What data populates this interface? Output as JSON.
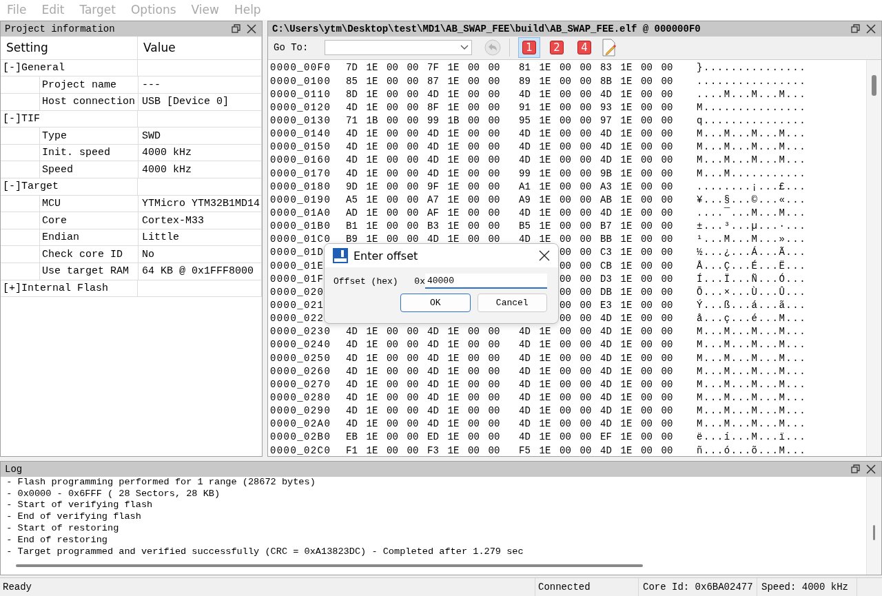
{
  "menu": [
    {
      "label": "File",
      "disabled": true
    },
    {
      "label": "Edit",
      "disabled": true
    },
    {
      "label": "Target",
      "disabled": true
    },
    {
      "label": "Options",
      "disabled": true
    },
    {
      "label": "View",
      "disabled": true
    },
    {
      "label": "Help",
      "disabled": true
    }
  ],
  "project_panel": {
    "title": "Project information",
    "columns": [
      "Setting",
      "Value"
    ],
    "groups": [
      {
        "toggle": "[-]",
        "label": "General",
        "children": [
          {
            "setting": "Project name",
            "value": "---"
          },
          {
            "setting": "Host connection",
            "value": "USB [Device 0]"
          }
        ]
      },
      {
        "toggle": "[-]",
        "label": "TIF",
        "children": [
          {
            "setting": "Type",
            "value": "SWD"
          },
          {
            "setting": "Init. speed",
            "value": "4000 kHz"
          },
          {
            "setting": "Speed",
            "value": "4000 kHz"
          }
        ]
      },
      {
        "toggle": "[-]",
        "label": "Target",
        "children": [
          {
            "setting": "MCU",
            "value": "YTMicro YTM32B1MD14"
          },
          {
            "setting": "Core",
            "value": "Cortex-M33"
          },
          {
            "setting": "Endian",
            "value": "Little"
          },
          {
            "setting": "Check core ID",
            "value": "No"
          },
          {
            "setting": "Use target RAM",
            "value": "64 KB @ 0x1FFF8000"
          }
        ]
      },
      {
        "toggle": "[+]",
        "label": "Internal Flash"
      }
    ]
  },
  "hex_panel": {
    "title": "C:\\Users\\ytm\\Desktop\\test\\MD1\\AB_SWAP_FEE\\build\\AB_SWAP_FEE.elf @ 000000F0",
    "goto_label": "Go To:",
    "view_buttons": [
      {
        "label": "1",
        "selected": true
      },
      {
        "label": "2",
        "selected": false
      },
      {
        "label": "4",
        "selected": false
      }
    ],
    "rows": [
      {
        "address": "0000_00F0",
        "bytes": [
          "7D",
          "1E",
          "00",
          "00",
          "7F",
          "1E",
          "00",
          "00",
          "81",
          "1E",
          "00",
          "00",
          "83",
          "1E",
          "00",
          "00"
        ],
        "ascii": "}..............."
      },
      {
        "address": "0000_0100",
        "bytes": [
          "85",
          "1E",
          "00",
          "00",
          "87",
          "1E",
          "00",
          "00",
          "89",
          "1E",
          "00",
          "00",
          "8B",
          "1E",
          "00",
          "00"
        ],
        "ascii": "................"
      },
      {
        "address": "0000_0110",
        "bytes": [
          "8D",
          "1E",
          "00",
          "00",
          "4D",
          "1E",
          "00",
          "00",
          "4D",
          "1E",
          "00",
          "00",
          "4D",
          "1E",
          "00",
          "00"
        ],
        "ascii": "....M...M...M..."
      },
      {
        "address": "0000_0120",
        "bytes": [
          "4D",
          "1E",
          "00",
          "00",
          "8F",
          "1E",
          "00",
          "00",
          "91",
          "1E",
          "00",
          "00",
          "93",
          "1E",
          "00",
          "00"
        ],
        "ascii": "M..............."
      },
      {
        "address": "0000_0130",
        "bytes": [
          "71",
          "1B",
          "00",
          "00",
          "99",
          "1B",
          "00",
          "00",
          "95",
          "1E",
          "00",
          "00",
          "97",
          "1E",
          "00",
          "00"
        ],
        "ascii": "q..............."
      },
      {
        "address": "0000_0140",
        "bytes": [
          "4D",
          "1E",
          "00",
          "00",
          "4D",
          "1E",
          "00",
          "00",
          "4D",
          "1E",
          "00",
          "00",
          "4D",
          "1E",
          "00",
          "00"
        ],
        "ascii": "M...M...M...M..."
      },
      {
        "address": "0000_0150",
        "bytes": [
          "4D",
          "1E",
          "00",
          "00",
          "4D",
          "1E",
          "00",
          "00",
          "4D",
          "1E",
          "00",
          "00",
          "4D",
          "1E",
          "00",
          "00"
        ],
        "ascii": "M...M...M...M..."
      },
      {
        "address": "0000_0160",
        "bytes": [
          "4D",
          "1E",
          "00",
          "00",
          "4D",
          "1E",
          "00",
          "00",
          "4D",
          "1E",
          "00",
          "00",
          "4D",
          "1E",
          "00",
          "00"
        ],
        "ascii": "M...M...M...M..."
      },
      {
        "address": "0000_0170",
        "bytes": [
          "4D",
          "1E",
          "00",
          "00",
          "4D",
          "1E",
          "00",
          "00",
          "99",
          "1E",
          "00",
          "00",
          "9B",
          "1E",
          "00",
          "00"
        ],
        "ascii": "M...M..........."
      },
      {
        "address": "0000_0180",
        "bytes": [
          "9D",
          "1E",
          "00",
          "00",
          "9F",
          "1E",
          "00",
          "00",
          "A1",
          "1E",
          "00",
          "00",
          "A3",
          "1E",
          "00",
          "00"
        ],
        "ascii": "........¡...£..."
      },
      {
        "address": "0000_0190",
        "bytes": [
          "A5",
          "1E",
          "00",
          "00",
          "A7",
          "1E",
          "00",
          "00",
          "A9",
          "1E",
          "00",
          "00",
          "AB",
          "1E",
          "00",
          "00"
        ],
        "ascii": "¥...§...©...«..."
      },
      {
        "address": "0000_01A0",
        "bytes": [
          "AD",
          "1E",
          "00",
          "00",
          "AF",
          "1E",
          "00",
          "00",
          "4D",
          "1E",
          "00",
          "00",
          "4D",
          "1E",
          "00",
          "00"
        ],
        "ascii": "....¯...M...M..."
      },
      {
        "address": "0000_01B0",
        "bytes": [
          "B1",
          "1E",
          "00",
          "00",
          "B3",
          "1E",
          "00",
          "00",
          "B5",
          "1E",
          "00",
          "00",
          "B7",
          "1E",
          "00",
          "00"
        ],
        "ascii": "±...³...µ...·..."
      },
      {
        "address": "0000_01C0",
        "bytes": [
          "B9",
          "1E",
          "00",
          "00",
          "4D",
          "1E",
          "00",
          "00",
          "4D",
          "1E",
          "00",
          "00",
          "BB",
          "1E",
          "00",
          "00"
        ],
        "ascii": "¹...M...M...»..."
      },
      {
        "address": "0000_01D",
        "kind": "covered",
        "bytes": [
          "00",
          "00",
          "C3",
          "1E",
          "00",
          "00"
        ],
        "ascii": "½...¿...Á...Ã..."
      },
      {
        "address": "0000_01E",
        "kind": "covered",
        "bytes": [
          "00",
          "00",
          "CB",
          "1E",
          "00",
          "00"
        ],
        "ascii": "Å...Ç...É...Ë..."
      },
      {
        "address": "0000_01F",
        "kind": "covered",
        "bytes": [
          "00",
          "00",
          "D3",
          "1E",
          "00",
          "00"
        ],
        "ascii": "Í...Ï...Ñ...Ó..."
      },
      {
        "address": "0000_020",
        "kind": "covered",
        "bytes": [
          "00",
          "00",
          "DB",
          "1E",
          "00",
          "00"
        ],
        "ascii": "Õ...×...Ù...Û..."
      },
      {
        "address": "0000_021",
        "kind": "covered",
        "bytes": [
          "00",
          "00",
          "E3",
          "1E",
          "00",
          "00"
        ],
        "ascii": "Ý...ß...á...ã..."
      },
      {
        "address": "0000_022",
        "kind": "covered",
        "bytes": [
          "00",
          "00",
          "4D",
          "1E",
          "00",
          "00"
        ],
        "ascii": "å...ç...é...M..."
      },
      {
        "address": "0000_0230",
        "bytes": [
          "4D",
          "1E",
          "00",
          "00",
          "4D",
          "1E",
          "00",
          "00",
          "4D",
          "1E",
          "00",
          "00",
          "4D",
          "1E",
          "00",
          "00"
        ],
        "ascii": "M...M...M...M..."
      },
      {
        "address": "0000_0240",
        "bytes": [
          "4D",
          "1E",
          "00",
          "00",
          "4D",
          "1E",
          "00",
          "00",
          "4D",
          "1E",
          "00",
          "00",
          "4D",
          "1E",
          "00",
          "00"
        ],
        "ascii": "M...M...M...M..."
      },
      {
        "address": "0000_0250",
        "bytes": [
          "4D",
          "1E",
          "00",
          "00",
          "4D",
          "1E",
          "00",
          "00",
          "4D",
          "1E",
          "00",
          "00",
          "4D",
          "1E",
          "00",
          "00"
        ],
        "ascii": "M...M...M...M..."
      },
      {
        "address": "0000_0260",
        "bytes": [
          "4D",
          "1E",
          "00",
          "00",
          "4D",
          "1E",
          "00",
          "00",
          "4D",
          "1E",
          "00",
          "00",
          "4D",
          "1E",
          "00",
          "00"
        ],
        "ascii": "M...M...M...M..."
      },
      {
        "address": "0000_0270",
        "bytes": [
          "4D",
          "1E",
          "00",
          "00",
          "4D",
          "1E",
          "00",
          "00",
          "4D",
          "1E",
          "00",
          "00",
          "4D",
          "1E",
          "00",
          "00"
        ],
        "ascii": "M...M...M...M..."
      },
      {
        "address": "0000_0280",
        "bytes": [
          "4D",
          "1E",
          "00",
          "00",
          "4D",
          "1E",
          "00",
          "00",
          "4D",
          "1E",
          "00",
          "00",
          "4D",
          "1E",
          "00",
          "00"
        ],
        "ascii": "M...M...M...M..."
      },
      {
        "address": "0000_0290",
        "bytes": [
          "4D",
          "1E",
          "00",
          "00",
          "4D",
          "1E",
          "00",
          "00",
          "4D",
          "1E",
          "00",
          "00",
          "4D",
          "1E",
          "00",
          "00"
        ],
        "ascii": "M...M...M...M..."
      },
      {
        "address": "0000_02A0",
        "bytes": [
          "4D",
          "1E",
          "00",
          "00",
          "4D",
          "1E",
          "00",
          "00",
          "4D",
          "1E",
          "00",
          "00",
          "4D",
          "1E",
          "00",
          "00"
        ],
        "ascii": "M...M...M...M..."
      },
      {
        "address": "0000_02B0",
        "bytes": [
          "EB",
          "1E",
          "00",
          "00",
          "ED",
          "1E",
          "00",
          "00",
          "4D",
          "1E",
          "00",
          "00",
          "EF",
          "1E",
          "00",
          "00"
        ],
        "ascii": "ë...í...M...ï..."
      },
      {
        "address": "0000_02C0",
        "bytes": [
          "F1",
          "1E",
          "00",
          "00",
          "F3",
          "1E",
          "00",
          "00",
          "F5",
          "1E",
          "00",
          "00",
          "4D",
          "1E",
          "00",
          "00"
        ],
        "ascii": "ñ...ó...õ...M..."
      }
    ]
  },
  "dialog": {
    "title": "Enter offset",
    "field_label": "Offset (hex)",
    "prefix": "0x",
    "value": "40000",
    "buttons": [
      {
        "label": "OK",
        "default": true
      },
      {
        "label": "Cancel",
        "default": false
      }
    ]
  },
  "log_panel": {
    "title": "Log",
    "lines": [
      " - Flash programming performed for 1 range (28672 bytes)",
      " - 0x0000 - 0x6FFF ( 28 Sectors, 28 KB)",
      " - Start of verifying flash",
      " - End of verifying flash",
      " - Start of restoring",
      " - End of restoring",
      " - Target programmed and verified successfully (CRC = 0xA13823DC) - Completed after 1.279 sec"
    ]
  },
  "status_bar": {
    "message": "Ready",
    "connection": "Connected",
    "core_id": "Core Id: 0x6BA02477",
    "speed": "Speed: 4000 kHz"
  }
}
